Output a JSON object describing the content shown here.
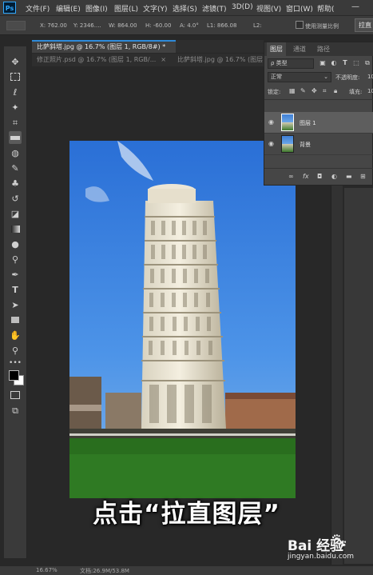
{
  "app": {
    "logo": "Ps"
  },
  "menu": [
    "文件(F)",
    "编辑(E)",
    "图像(I)",
    "图层(L)",
    "文字(Y)",
    "选择(S)",
    "滤镜(T)",
    "3D(D)",
    "视图(V)",
    "窗口(W)",
    "帮助("
  ],
  "options_bar": {
    "x": "X: 762.00",
    "y": "Y: 2346....",
    "w": "W: 864.00",
    "h": "H: -60.00",
    "a": "A: 4.0°",
    "l1": "L1: 866.08",
    "l2": "L2:",
    "checkbox_label": "使用测量比例",
    "straighten_button": "拉直"
  },
  "doc_tabs": [
    {
      "label": "比萨斜塔.jpg @ 16.7% (图层 1, RGB/8#) *",
      "active": true
    },
    {
      "label": "修正照片.psd @ 16.7% (图层 1, RGB/...",
      "active": false
    },
    {
      "label": "比萨斜塔.jpg @ 16.7% (图层 1, RGB/8...",
      "active": false
    }
  ],
  "layers_panel": {
    "tabs": [
      "图层",
      "通道",
      "路径"
    ],
    "filter_label": "ρ 类型",
    "blend_mode": "正常",
    "opacity_label": "不透明度:",
    "opacity_value": "10",
    "lock_label": "锁定:",
    "fill_label": "填充:",
    "fill_value": "10",
    "layers": [
      {
        "name": "图层 1",
        "selected": true
      },
      {
        "name": "背景",
        "selected": false
      }
    ],
    "footer_icons": [
      "link-icon",
      "fx-icon",
      "mask-icon",
      "adjustment-icon",
      "group-icon",
      "new-layer-icon"
    ]
  },
  "status_bar": {
    "zoom": "16.67%",
    "doc": "文档:26.9M/53.8M"
  },
  "caption": "点击“拉直图层”",
  "watermark": {
    "brand": "Bai  经验",
    "url": "jingyan.baidu.com"
  }
}
